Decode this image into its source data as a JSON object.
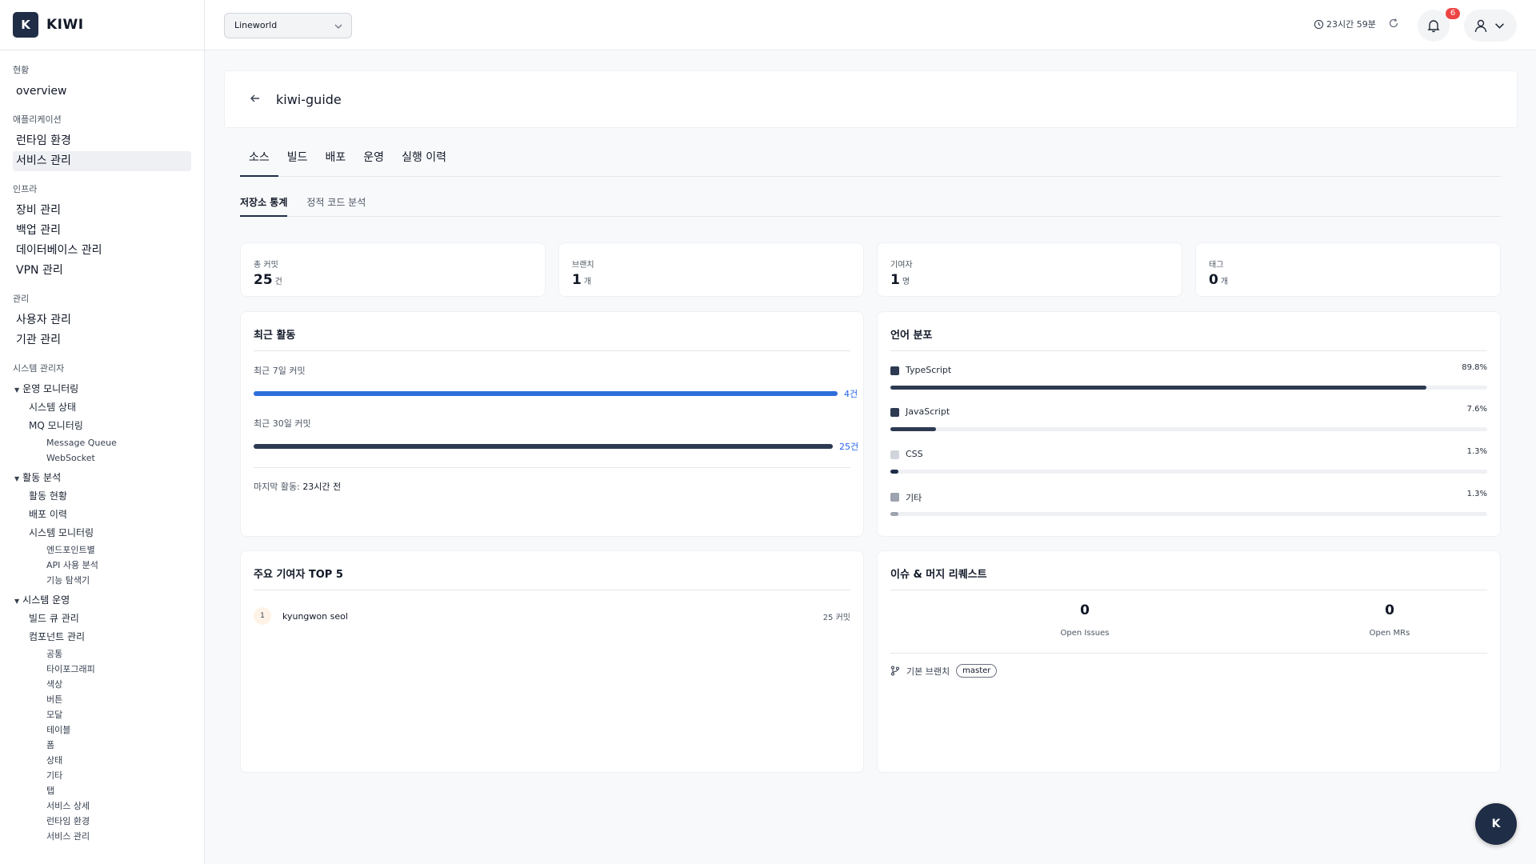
{
  "app": {
    "logo_letter": "K",
    "name": "KIWI"
  },
  "sidebar": {
    "sections": [
      {
        "label": "현황",
        "items": [
          "overview"
        ]
      },
      {
        "label": "애플리케이션",
        "items": [
          "런타임 환경",
          "서비스 관리"
        ]
      },
      {
        "label": "인프라",
        "items": [
          "장비 관리",
          "백업 관리",
          "데이터베이스 관리",
          "VPN 관리"
        ]
      },
      {
        "label": "관리",
        "items": [
          "사용자 관리",
          "기관 관리"
        ]
      }
    ],
    "admin_label": "시스템 관리자",
    "groups": [
      {
        "label": "운영 모니터링"
      },
      {
        "label": "활동 분석"
      },
      {
        "label": "시스템 운영"
      }
    ],
    "op_monitor": {
      "system_status": "시스템 상태",
      "mq": "MQ 모니터링",
      "mq_children": [
        "Message Queue",
        "WebSocket"
      ]
    },
    "activity": {
      "status": "활동 현황",
      "deploy_history": "배포 이력",
      "sys_monitor": "시스템 모니터링",
      "sys_children": [
        "엔드포인트별",
        "API 사용 분석",
        "기능 탐색기"
      ]
    },
    "sysops": {
      "build_queue": "빌드 큐 관리",
      "component": "컴포넌트 관리",
      "component_children": [
        "공통",
        "타이포그래피",
        "색상",
        "버튼",
        "모달",
        "테이블",
        "폼",
        "상태",
        "기타",
        "탭",
        "서비스 상세",
        "런타임 환경",
        "서비스 관리"
      ]
    }
  },
  "topbar": {
    "workspace": "Lineworld",
    "session_time": "23시간 59분",
    "notification_count": "6"
  },
  "page": {
    "title": "kiwi-guide"
  },
  "tabs": [
    "소스",
    "빌드",
    "배포",
    "운영",
    "실행 이력"
  ],
  "subtabs": [
    "저장소 통계",
    "정적 코드 분석"
  ],
  "stats": [
    {
      "label": "총 커밋",
      "value": "25",
      "unit": "건"
    },
    {
      "label": "브랜치",
      "value": "1",
      "unit": "개"
    },
    {
      "label": "기여자",
      "value": "1",
      "unit": "명"
    },
    {
      "label": "태그",
      "value": "0",
      "unit": "개"
    }
  ],
  "recent": {
    "title": "최근 활동",
    "commits_7d_label": "최근 7일 커밋",
    "commits_7d_value": "4건",
    "commits_7d_fraction": 1.0,
    "commits_30d_label": "최근 30일 커밋",
    "commits_30d_value": "25건",
    "commits_30d_fraction": 1.0,
    "last_activity_label": "마지막 활동:",
    "last_activity_value": "23시간 전"
  },
  "languages": {
    "title": "언어 분포",
    "items": [
      {
        "name": "TypeScript",
        "pct": "89.8%",
        "fraction": 0.898,
        "color": "#2d3a52"
      },
      {
        "name": "JavaScript",
        "pct": "7.6%",
        "fraction": 0.076,
        "color": "#2d3a52"
      },
      {
        "name": "CSS",
        "pct": "1.3%",
        "fraction": 0.013,
        "color": "#d1d5db"
      },
      {
        "name": "기타",
        "pct": "1.3%",
        "fraction": 0.013,
        "color": "#9ca3af"
      }
    ]
  },
  "contributors": {
    "title": "주요 기여자 TOP 5",
    "items": [
      {
        "rank": "1",
        "name": "kyungwon seol",
        "commits": "25 커밋"
      }
    ]
  },
  "issues": {
    "title": "이슈 & 머지 리퀘스트",
    "open_issues_value": "0",
    "open_issues_label": "Open Issues",
    "open_mrs_value": "0",
    "open_mrs_label": "Open MRs",
    "default_branch_label": "기본 브랜치",
    "default_branch": "master"
  },
  "fab": {
    "letter": "K"
  },
  "colors": {
    "primary": "#1f2d46",
    "accent_blue": "#2563eb",
    "badge_red": "#ef4444"
  }
}
